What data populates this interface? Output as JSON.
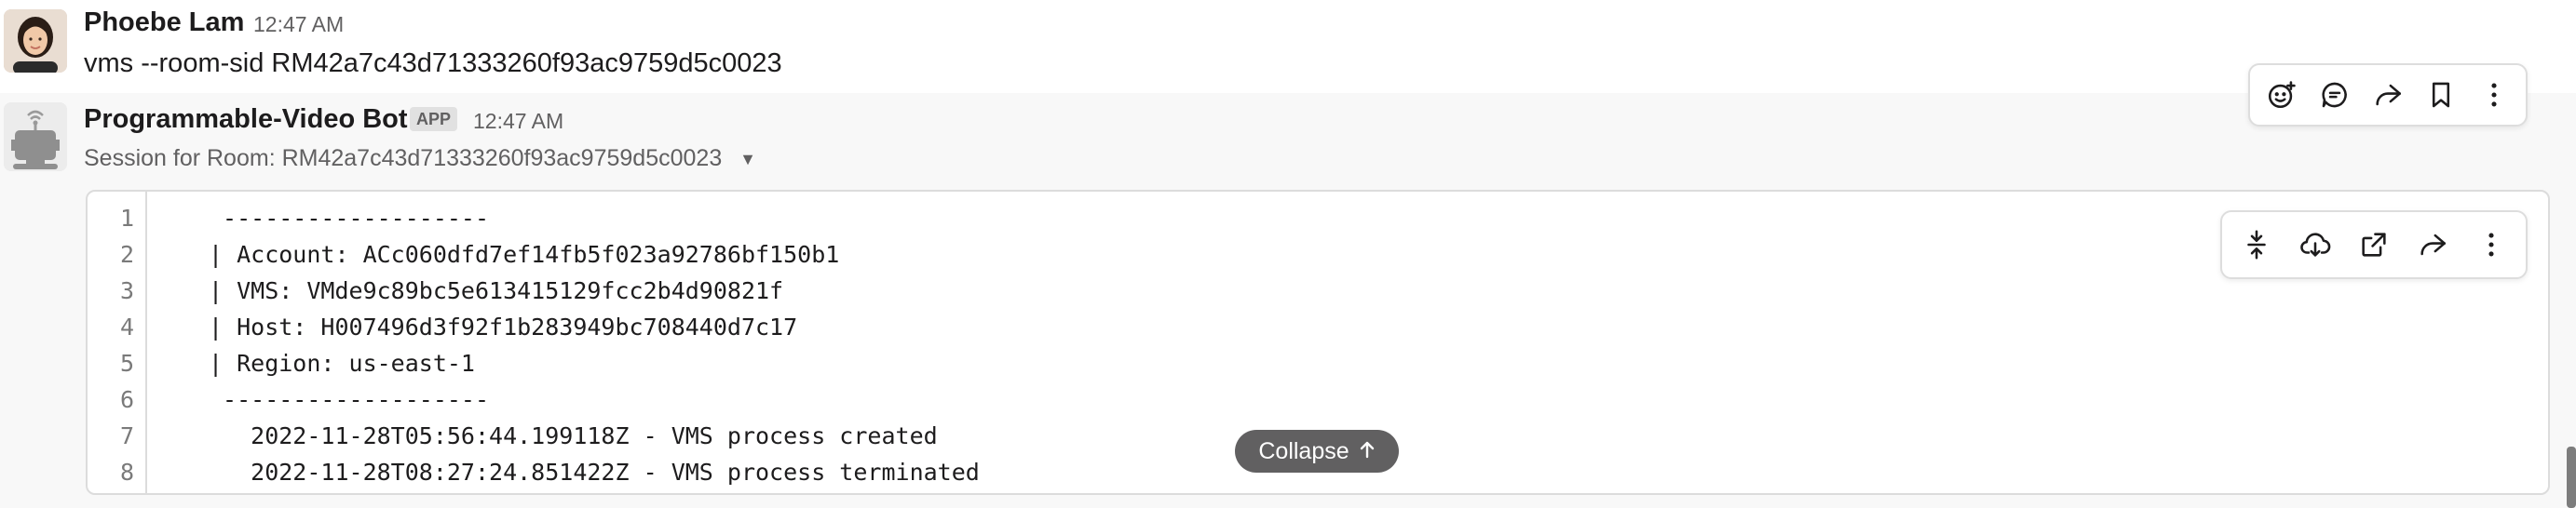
{
  "message1": {
    "sender": "Phoebe Lam",
    "time": "12:47 AM",
    "text": "vms --room-sid RM42a7c43d71333260f93ac9759d5c0023"
  },
  "message2": {
    "sender": "Programmable-Video Bot",
    "badge": "APP",
    "time": "12:47 AM",
    "attachment_title": "Session for Room: RM42a7c43d71333260f93ac9759d5c0023",
    "code": {
      "line_numbers": [
        "1",
        "2",
        "3",
        "4",
        "5",
        "6",
        "7",
        "8"
      ],
      "lines": [
        " -------------------",
        "| Account: ACc060dfd7ef14fb5f023a92786bf150b1",
        "| VMS: VMde9c89bc5e613415129fcc2b4d90821f",
        "| Host: H007496d3f92f1b283949bc708440d7c17",
        "| Region: us-east-1",
        " -------------------",
        "   2022-11-28T05:56:44.199118Z - VMS process created",
        "   2022-11-28T08:27:24.851422Z - VMS process terminated"
      ]
    },
    "collapse_label": "Collapse"
  },
  "message_actions": [
    "add-reaction-icon",
    "reply-in-thread-icon",
    "share-icon",
    "bookmark-icon",
    "more-actions-icon"
  ],
  "code_actions": [
    "collapse-lines-icon",
    "download-icon",
    "open-external-icon",
    "share-icon",
    "more-actions-icon"
  ],
  "colors": {
    "hover_background": "#f8f8f8",
    "muted_text": "#616061",
    "collapse_button_bg": "#616061"
  }
}
